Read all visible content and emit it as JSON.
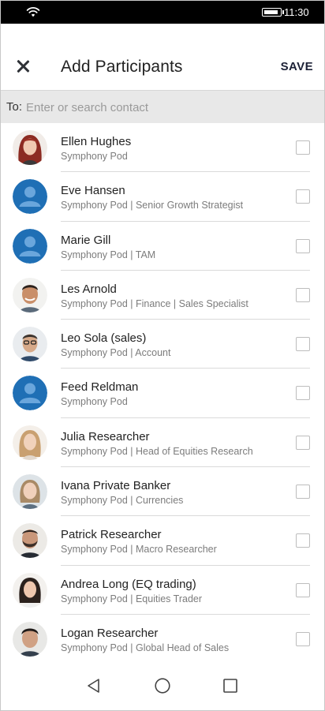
{
  "status_bar": {
    "time": "11:30",
    "battery_level": 0.75
  },
  "header": {
    "title": "Add Participants",
    "save_label": "SAVE"
  },
  "to_field": {
    "label": "To:",
    "placeholder": "Enter or search contact",
    "value": ""
  },
  "contacts": [
    {
      "name": "Ellen Hughes",
      "subtitle": "Symphony Pod",
      "avatar": "photo-red-hair-woman",
      "checked": false
    },
    {
      "name": "Eve Hansen",
      "subtitle": "Symphony Pod | Senior Growth Strategist",
      "avatar": "default-person-icon",
      "checked": false
    },
    {
      "name": "Marie Gill",
      "subtitle": "Symphony Pod | TAM",
      "avatar": "default-person-icon",
      "checked": false
    },
    {
      "name": "Les Arnold",
      "subtitle": "Symphony Pod | Finance | Sales Specialist",
      "avatar": "photo-man-smiling",
      "checked": false
    },
    {
      "name": "Leo Sola (sales)",
      "subtitle": "Symphony Pod | Account",
      "avatar": "photo-man-glasses",
      "checked": false
    },
    {
      "name": "Feed Reldman",
      "subtitle": "Symphony Pod",
      "avatar": "default-person-icon",
      "checked": false
    },
    {
      "name": "Julia Researcher",
      "subtitle": "Symphony Pod | Head of Equities Research",
      "avatar": "photo-blonde-woman",
      "checked": false
    },
    {
      "name": "Ivana Private Banker",
      "subtitle": "Symphony Pod | Currencies",
      "avatar": "photo-woman-light-hair",
      "checked": false
    },
    {
      "name": "Patrick Researcher",
      "subtitle": "Symphony Pod | Macro Researcher",
      "avatar": "photo-bearded-man",
      "checked": false
    },
    {
      "name": "Andrea Long (EQ trading)",
      "subtitle": "Symphony Pod | Equities Trader",
      "avatar": "photo-dark-hair-woman",
      "checked": false
    },
    {
      "name": "Logan Researcher",
      "subtitle": "Symphony Pod | Global Head of Sales",
      "avatar": "photo-dark-hair-man",
      "checked": false
    }
  ],
  "colors": {
    "accent": "#1f6fb5",
    "status_bar": "#000000",
    "to_bar": "#e8e8e8",
    "save_text": "#1c2136"
  },
  "icons": {
    "close": "close-icon",
    "wifi": "wifi-icon",
    "battery": "battery-icon",
    "nav_back": "back-triangle-icon",
    "nav_home": "home-circle-icon",
    "nav_recent": "recent-apps-square-icon"
  }
}
